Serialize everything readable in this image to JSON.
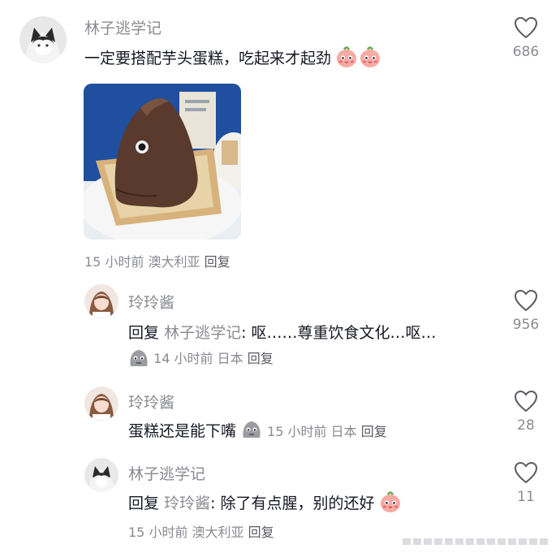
{
  "comments": [
    {
      "user": "林子逃学记",
      "text": "一定要搭配芋头蛋糕，吃起来才起劲",
      "time": "15 小时前",
      "location": "澳大利亚",
      "reply_label": "回复",
      "likes": "686",
      "emoji": "blush-peach-emoji"
    },
    {
      "user": "玲玲酱",
      "reply_prefix": "回复",
      "reply_to": "林子逃学记",
      "text": ": 呕……尊重饮食文化…呕…",
      "time": "14 小时前",
      "location": "日本",
      "reply_label": "回复",
      "likes": "956",
      "emoji": "gray-blob-emoji"
    },
    {
      "user": "玲玲酱",
      "text": "蛋糕还是能下嘴",
      "time": "15 小时前",
      "location": "日本",
      "reply_label": "回复",
      "likes": "28",
      "emoji": "gray-blob-emoji"
    },
    {
      "user": "林子逃学记",
      "reply_prefix": "回复",
      "reply_to": "玲玲酱",
      "text": ": 除了有点腥，别的还好",
      "time": "15 小时前",
      "location": "澳大利亚",
      "reply_label": "回复",
      "likes": "11",
      "emoji": "blush-peach-emoji"
    }
  ],
  "colors": {
    "text": "#161823",
    "secondary": "#8a8b91",
    "photo_background": "#1f4f9e"
  }
}
